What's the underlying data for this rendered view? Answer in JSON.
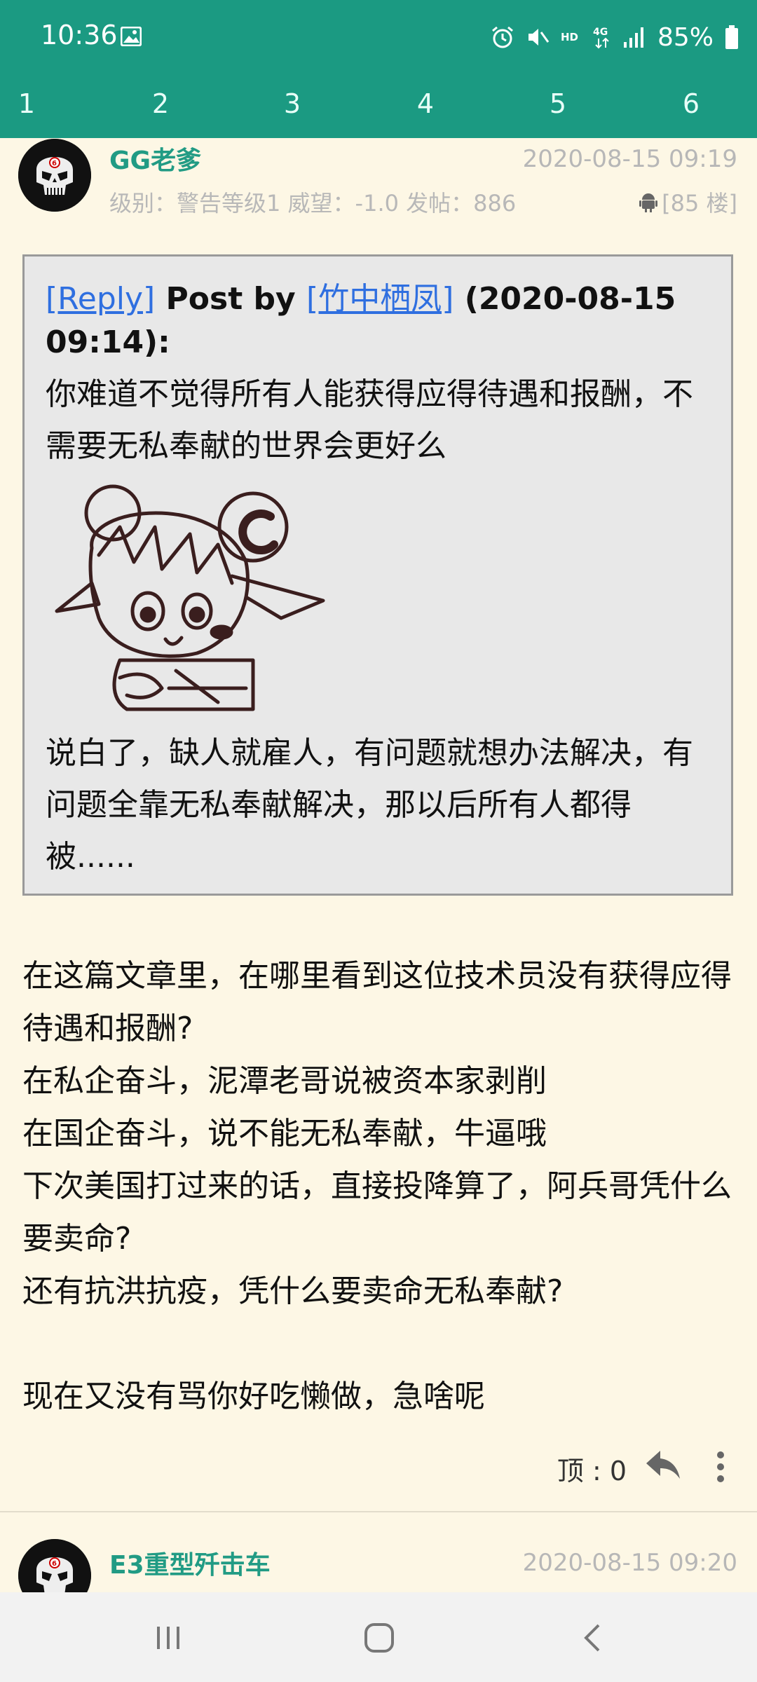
{
  "status_bar": {
    "time": "10:36",
    "battery": "85%",
    "icons": [
      "image-icon",
      "alarm-icon",
      "mute-icon",
      "hd-icon",
      "4g-icon",
      "signal-icon",
      "battery-icon"
    ]
  },
  "tabs": [
    "1",
    "2",
    "3",
    "4",
    "5",
    "6"
  ],
  "colors": {
    "header": "#1b9a82",
    "background": "#fdf7e5",
    "username": "#219b84",
    "link": "#2f6fe0",
    "quote_bg": "#e8e8e8"
  },
  "post": {
    "username": "GG老爹",
    "date": "2020-08-15 09:19",
    "meta": "级别：警告等级1   威望：-1.0   发帖：886",
    "floor": "[85 楼]",
    "quote": {
      "reply_link": "[Reply]",
      "post_by": " Post by ",
      "author_link": "[竹中栖凤]",
      "time": " (2020-08-15 09:14):",
      "text1": "你难道不觉得所有人能获得应得待遇和报酬，不需要无私奉献的世界会更好么",
      "text2": "说白了，缺人就雇人，有问题就想办法解决，有问题全靠无私奉献解决，那以后所有人都得被......"
    },
    "body": "在这篇文章里，在哪里看到这位技术员没有获得应得待遇和报酬?\n在私企奋斗，泥潭老哥说被资本家剥削\n在国企奋斗，说不能无私奉献，牛逼哦\n下次美国打过来的话，直接投降算了，阿兵哥凭什么要卖命?\n还有抗洪抗疫，凭什么要卖命无私奉献?\n\n现在又没有骂你好吃懒做，急啥呢",
    "upvote": "顶 : 0"
  },
  "next_post": {
    "username": "E3重型歼击车",
    "date": "2020-08-15 09:20"
  }
}
